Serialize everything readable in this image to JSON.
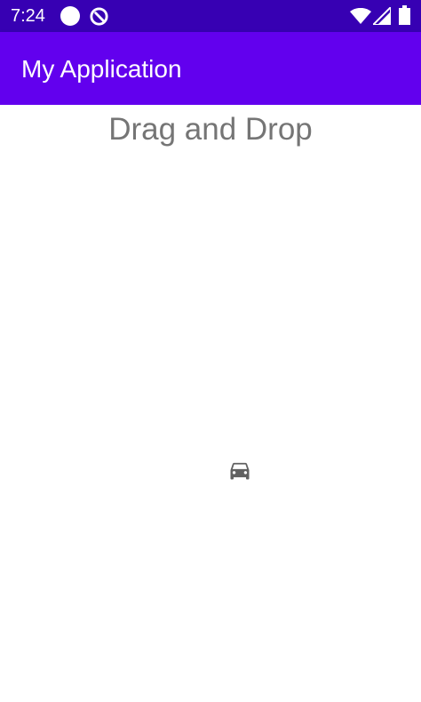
{
  "status_bar": {
    "time": "7:24",
    "icons": [
      "dot-icon",
      "q-icon",
      "wifi-icon",
      "signal-icon",
      "battery-icon"
    ]
  },
  "app_bar": {
    "title": "My Application",
    "color": "#6200ee"
  },
  "content": {
    "title": "Drag and Drop",
    "draggable_icon": "car-icon"
  },
  "colors": {
    "status_bar": "#3700b3",
    "app_bar": "#6200ee",
    "title_text": "#757575",
    "icon": "#616161"
  }
}
